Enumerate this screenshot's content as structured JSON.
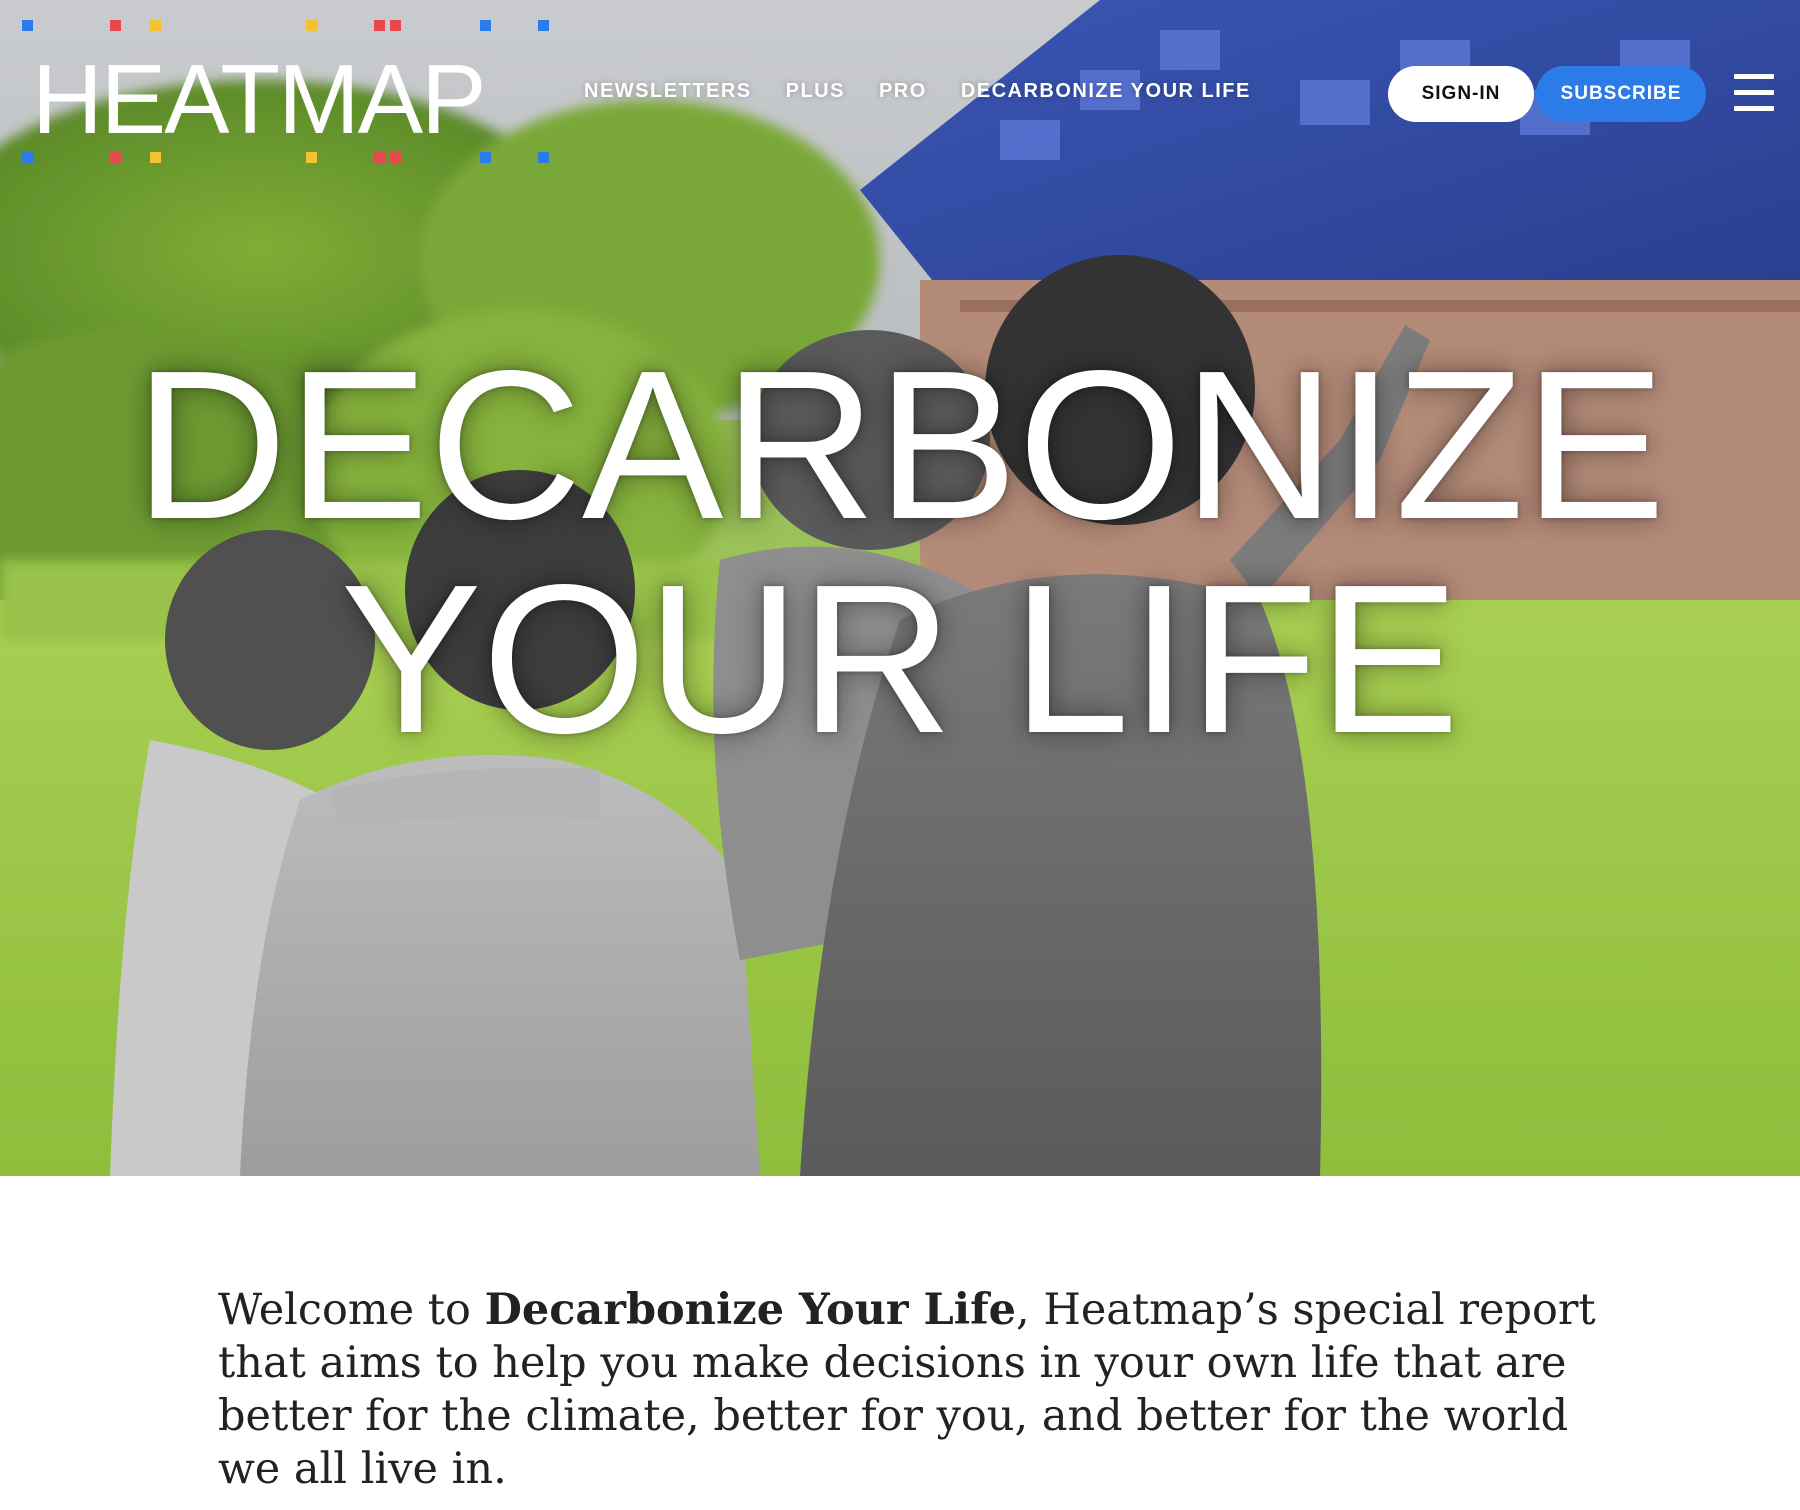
{
  "colors": {
    "accent_blue": "#2b7ce8",
    "logo_dot_blue": "#2b7ce8",
    "logo_dot_red": "#e5484d",
    "logo_dot_yellow": "#f2c230",
    "text_white": "#ffffff",
    "body_text": "#222222"
  },
  "header": {
    "logo_text": "HEATMAP",
    "nav": [
      {
        "label": "NEWSLETTERS"
      },
      {
        "label": "PLUS"
      },
      {
        "label": "PRO"
      },
      {
        "label": "DECARBONIZE YOUR LIFE"
      }
    ],
    "signin_label": "SIGN-IN",
    "subscribe_label": "SUBSCRIBE",
    "menu_icon": "hamburger-menu-icon"
  },
  "hero": {
    "image": "family-in-field-with-solar-house-photo",
    "headline_line1": "DECARBONIZE",
    "headline_line2": "YOUR LIFE"
  },
  "intro": {
    "prefix": "Welcome to ",
    "emphasis": "Decarbonize Your Life",
    "suffix": ", Heatmap’s special report that aims to help you make decisions in your own life that are better for the climate, better for you, and better for the world we all live in."
  }
}
